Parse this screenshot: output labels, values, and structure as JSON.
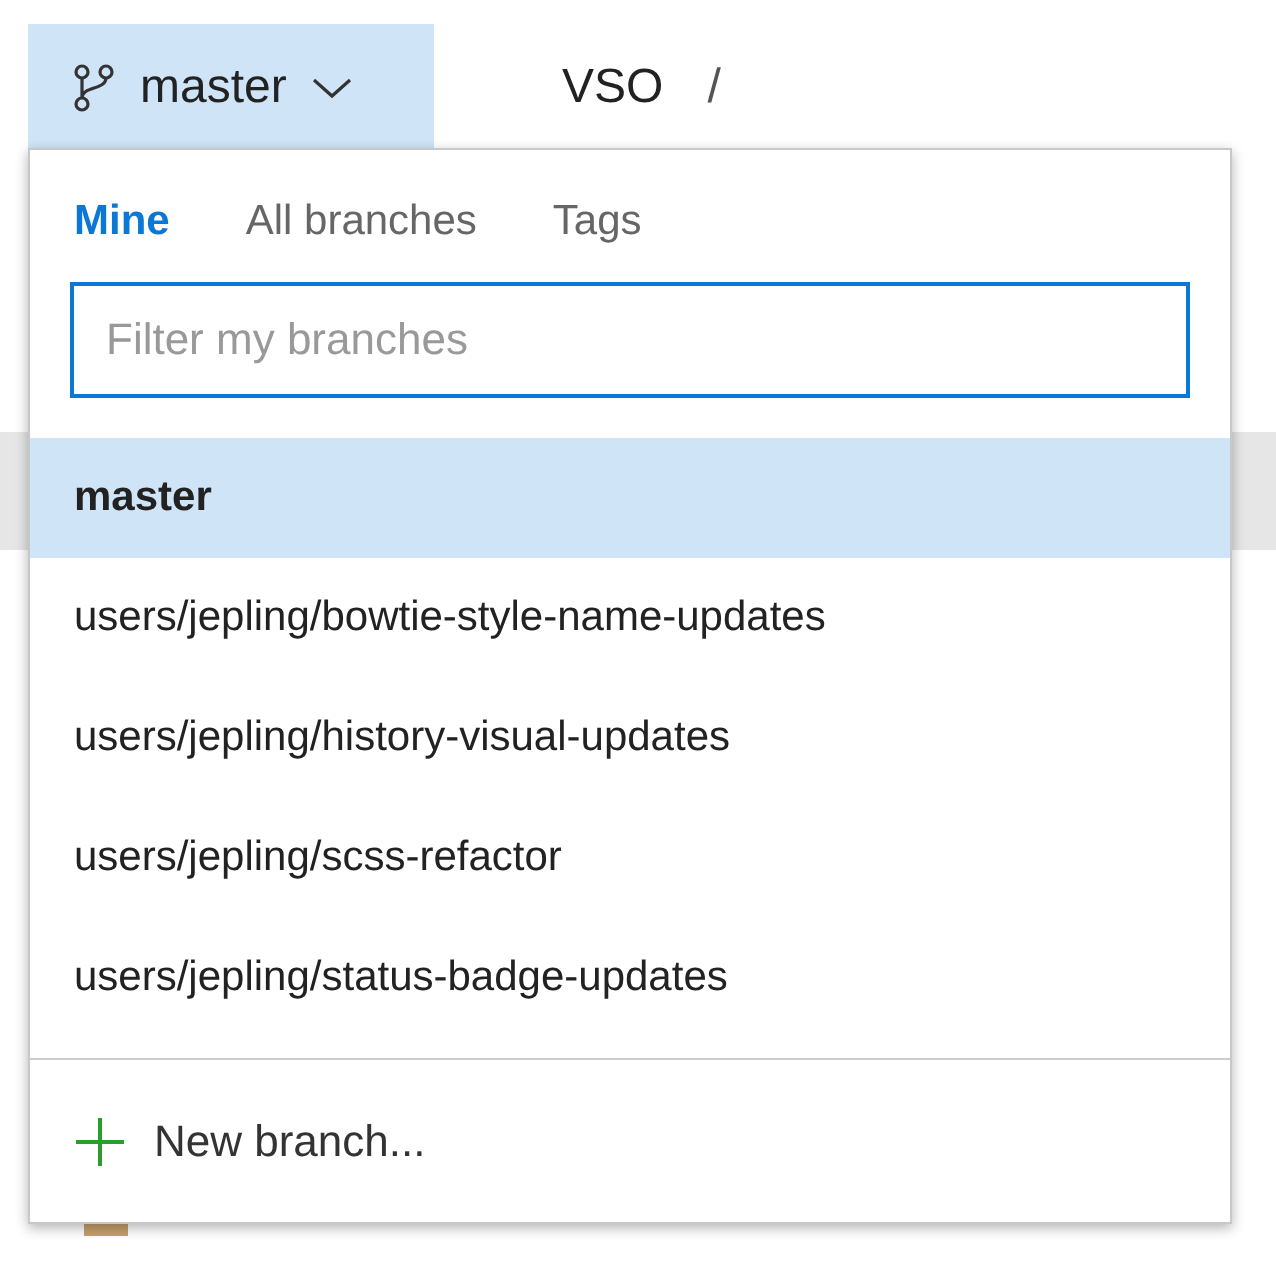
{
  "branch_button": {
    "label": "master"
  },
  "breadcrumb": {
    "repo": "VSO",
    "separator": "/"
  },
  "branch_menu": {
    "tabs": [
      {
        "label": "Mine",
        "selected": true
      },
      {
        "label": "All branches",
        "selected": false
      },
      {
        "label": "Tags",
        "selected": false
      }
    ],
    "filter": {
      "placeholder": "Filter my branches"
    },
    "branches": [
      {
        "name": "master",
        "selected": true
      },
      {
        "name": "users/jepling/bowtie-style-name-updates",
        "selected": false
      },
      {
        "name": "users/jepling/history-visual-updates",
        "selected": false
      },
      {
        "name": "users/jepling/scss-refactor",
        "selected": false
      },
      {
        "name": "users/jepling/status-badge-updates",
        "selected": false
      }
    ],
    "new_branch": {
      "label": "New branch..."
    }
  }
}
